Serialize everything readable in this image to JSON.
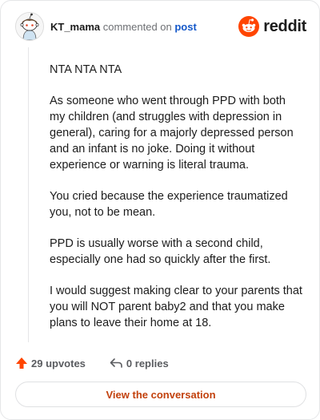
{
  "comment": {
    "username": "KT_mama",
    "action_text": " commented on ",
    "post_link": "post",
    "paragraphs": [
      "NTA NTA NTA",
      "As someone who went through PPD with both my children (and struggles with depression in general), caring for a majorly depressed person and an infant is no joke. Doing it without experience or warning is literal trauma.",
      "You cried because the experience traumatized you, not to be mean.",
      "PPD is usually worse with a second child, especially one had so quickly after the first.",
      "I would suggest making clear to your parents that you will NOT parent baby2 and that you make plans to leave their home at 18."
    ]
  },
  "brand": {
    "name": "reddit",
    "color": "#ff4500"
  },
  "actions": {
    "upvotes_label": "29 upvotes",
    "replies_label": "0 replies"
  },
  "cta": {
    "label": "View the conversation"
  },
  "icons": {
    "avatar": "snoo-avatar",
    "brand": "reddit-snoo-logo-icon",
    "upvote": "upvote-arrow-icon",
    "reply": "reply-arrow-icon"
  },
  "colors": {
    "upvote": "#ff4500",
    "link": "#1458c9",
    "cta_text": "#c2410c"
  }
}
